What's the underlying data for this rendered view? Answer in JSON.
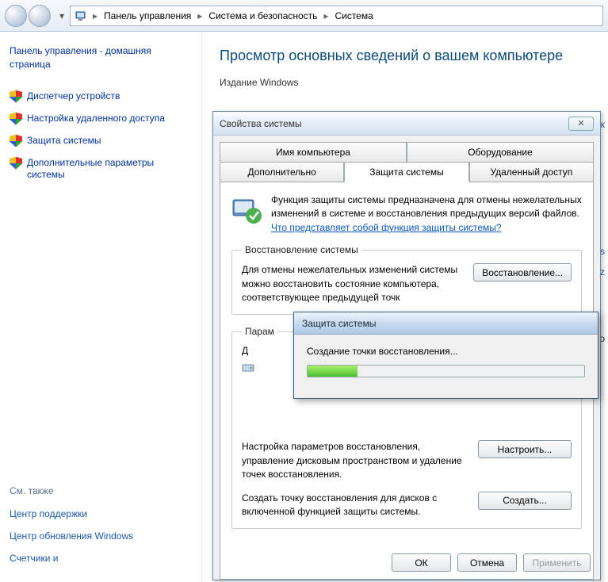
{
  "breadcrumb": {
    "items": [
      "Панель управления",
      "Система и безопасность",
      "Система"
    ]
  },
  "sidebar": {
    "home": "Панель управления - домашняя страница",
    "links": [
      "Диспетчер устройств",
      "Настройка удаленного доступа",
      "Защита системы",
      "Дополнительные параметры системы"
    ],
    "see_also_title": "См. также",
    "see_also": [
      "Центр поддержки",
      "Центр обновления Windows",
      "Счетчики и"
    ]
  },
  "main": {
    "heading": "Просмотр основных сведений о вашем компьютере",
    "edition_label": "Издание Windows",
    "partials": {
      "p1": "уск",
      "p2": "/s",
      "p3": "GHz",
      "p4": "ого"
    }
  },
  "dialog": {
    "title": "Свойства системы",
    "tabs_top": [
      "Имя компьютера",
      "Оборудование"
    ],
    "tabs_bottom": [
      "Дополнительно",
      "Защита системы",
      "Удаленный доступ"
    ],
    "info": {
      "text1": "Функция защиты системы предназначена для отмены нежелательных изменений в системе и восстановления предыдущих версий файлов. ",
      "link": "Что представляет собой функция защиты системы?"
    },
    "restore_group": {
      "legend": "Восстановление системы",
      "text": "Для отмены нежелательных изменений системы можно восстановить состояние компьютера, соответствующее предыдущей точк",
      "button": "Восстановление..."
    },
    "param_group": {
      "legend": "Парам",
      "row0": "Д",
      "text1": "Настройка параметров восстановления, управление дисковым пространством и удаление точек восстановления.",
      "button1": "Настроить...",
      "text2": "Создать точку восстановления для дисков с включенной функцией защиты системы.",
      "button2": "Создать..."
    },
    "buttons": {
      "ok": "ОК",
      "cancel": "Отмена",
      "apply": "Применить"
    }
  },
  "progress": {
    "title": "Защита системы",
    "text": "Создание точки восстановления..."
  }
}
